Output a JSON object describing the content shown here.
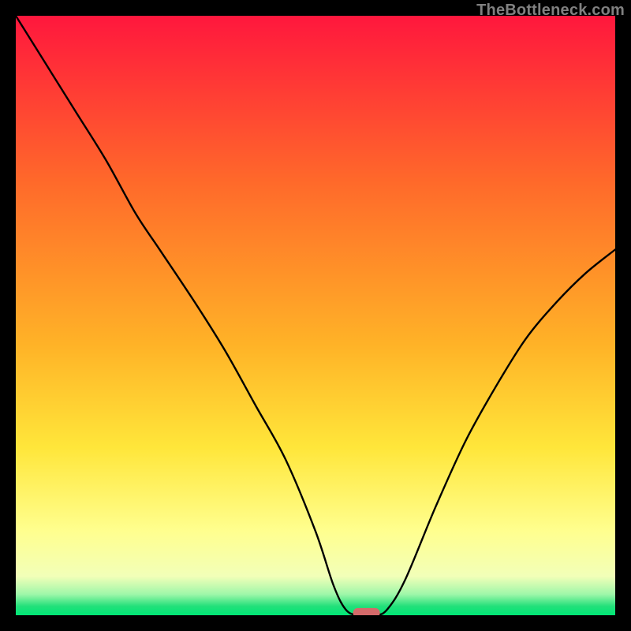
{
  "attribution": "TheBottleneck.com",
  "chart_data": {
    "type": "line",
    "title": "",
    "xlabel": "",
    "ylabel": "",
    "xlim": [
      0,
      100
    ],
    "ylim": [
      0,
      100
    ],
    "grid": false,
    "legend": false,
    "background": {
      "style": "vertical-heatmap-gradient",
      "description": "Vertical gradient from red (top / high bottleneck) through orange and yellow to green (bottom / low bottleneck), with a thin bright-green band at the very bottom.",
      "stops": [
        {
          "pos": 0.0,
          "color": "#ff173d"
        },
        {
          "pos": 0.28,
          "color": "#ff6a2a"
        },
        {
          "pos": 0.55,
          "color": "#ffb327"
        },
        {
          "pos": 0.72,
          "color": "#ffe63a"
        },
        {
          "pos": 0.86,
          "color": "#ffff8f"
        },
        {
          "pos": 0.935,
          "color": "#f2ffb8"
        },
        {
          "pos": 0.965,
          "color": "#9ff7a9"
        },
        {
          "pos": 0.985,
          "color": "#22e07a"
        },
        {
          "pos": 1.0,
          "color": "#00e676"
        }
      ]
    },
    "series": [
      {
        "name": "bottleneck-curve",
        "color": "#000000",
        "stroke_width": 2.4,
        "x": [
          0,
          5,
          10,
          15,
          20,
          24,
          30,
          35,
          40,
          45,
          50,
          53,
          55,
          57,
          60,
          62,
          65,
          70,
          75,
          80,
          85,
          90,
          95,
          100
        ],
        "y": [
          100,
          92,
          84,
          76,
          67,
          61,
          52,
          44,
          35,
          26,
          14,
          5,
          1,
          0,
          0,
          1,
          6,
          18,
          29,
          38,
          46,
          52,
          57,
          61
        ]
      }
    ],
    "marker": {
      "name": "optimal-point",
      "shape": "rounded-pill",
      "x": 58.5,
      "y": 0,
      "width": 4.5,
      "height": 1.6,
      "color": "#d46a6a"
    }
  }
}
